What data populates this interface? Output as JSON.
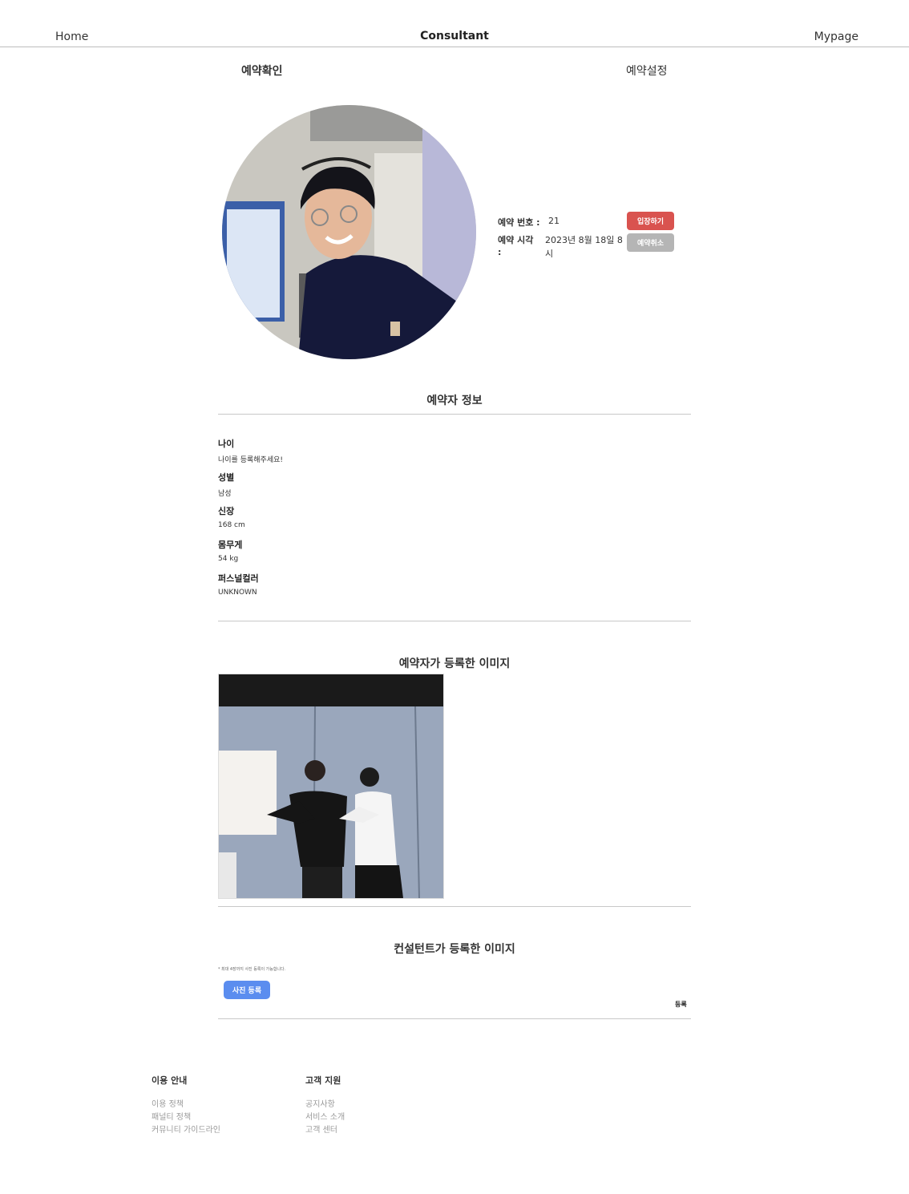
{
  "header": {
    "home_label": "Home",
    "title": "Consultant",
    "mypage_label": "Mypage"
  },
  "tabs": {
    "confirm_label": "예약확인",
    "settings_label": "예약설정"
  },
  "reservation": {
    "number_label": "예약 번호 :",
    "number_value": "21",
    "time_label": "예약 시각",
    "time_colon": ":",
    "time_value": "2023년 8월 18일 8시",
    "enter_button": "입장하기",
    "cancel_button": "예약취소"
  },
  "reserver_info": {
    "section_title": "예약자 정보",
    "fields": [
      {
        "label": "나이",
        "value": "나이를 등록해주세요!"
      },
      {
        "label": "성별",
        "value": "남성"
      },
      {
        "label": "신장",
        "value": "168 cm"
      },
      {
        "label": "몸무게",
        "value": "54 kg"
      },
      {
        "label": "퍼스널컬러",
        "value": "UNKNOWN"
      }
    ]
  },
  "user_images": {
    "section_title": "예약자가 등록한 이미지"
  },
  "consultant_images": {
    "section_title": "컨설턴트가 등록한 이미지",
    "note": "* 최대 4장까지 사진 등록이 가능합니다.",
    "upload_button": "사진 등록",
    "register_button": "등록"
  },
  "footer": {
    "usage": {
      "title": "이용 안내",
      "links": [
        "이용 정책",
        "패널티 정책",
        "커뮤니티 가이드라인"
      ]
    },
    "support": {
      "title": "고객 지원",
      "links": [
        "공지사항",
        "서비스 소개",
        "고객 센터"
      ]
    }
  },
  "colors": {
    "enter_button": "#d9534f",
    "cancel_button": "#b5b5b5",
    "upload_button": "#5b8def",
    "divider": "#c8c8c8"
  }
}
